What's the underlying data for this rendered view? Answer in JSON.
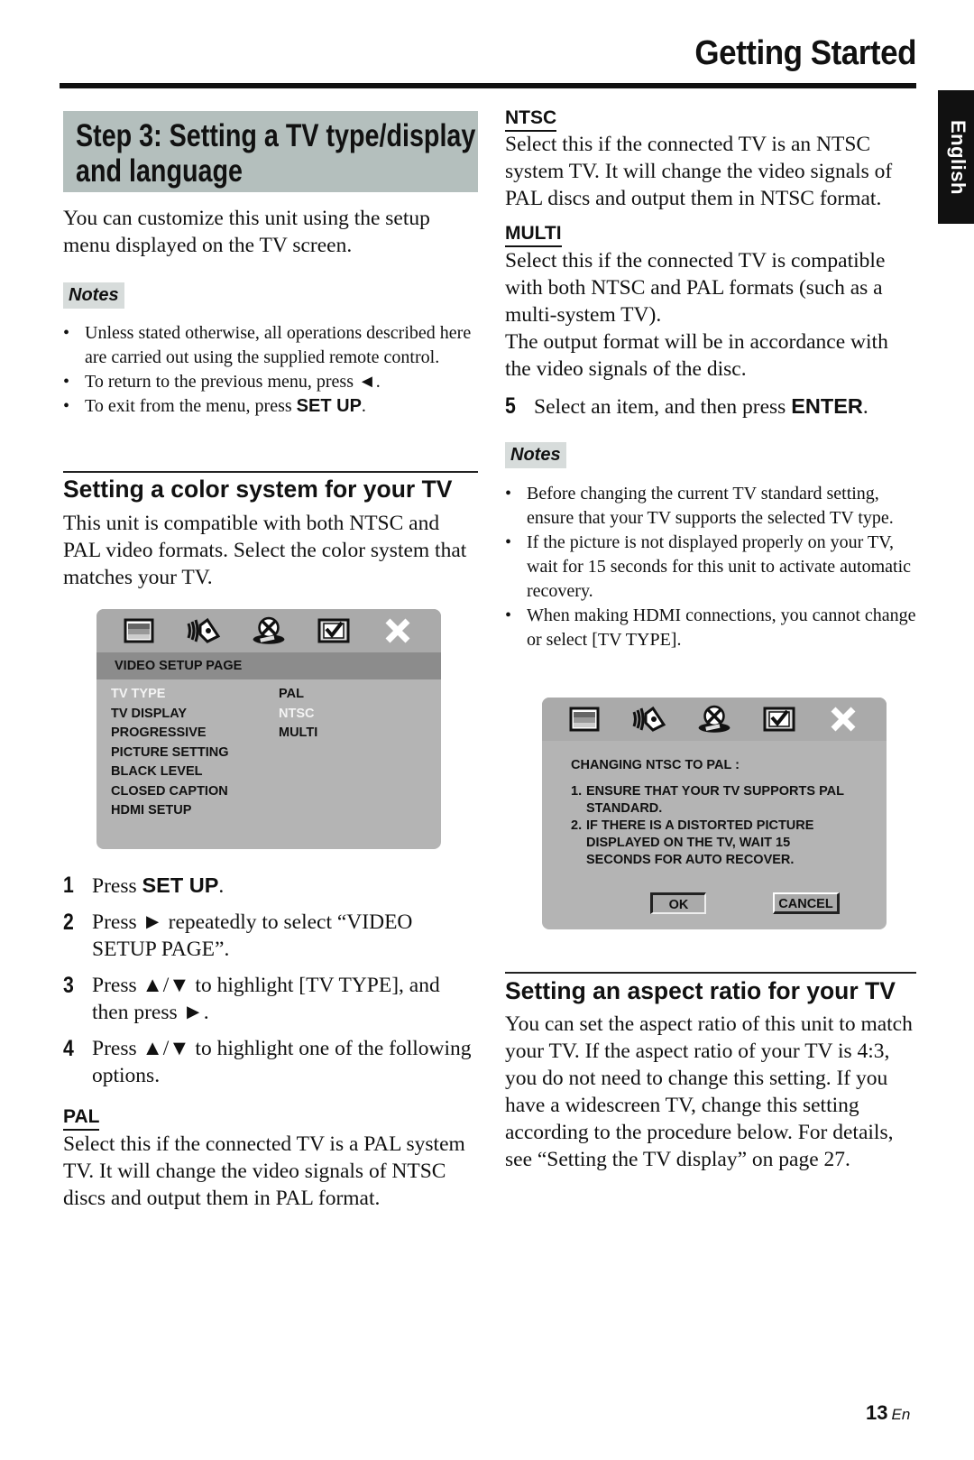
{
  "header": {
    "title": "Getting Started",
    "language_tab": "English"
  },
  "left": {
    "step_title_line1": "Step 3: Setting a TV type/display",
    "step_title_line2": "and language",
    "intro": "You can customize this unit using the setup menu displayed on the TV screen.",
    "notes": {
      "label": "Notes",
      "items": [
        {
          "text": "Unless stated otherwise, all operations described here are carried out using the supplied remote control."
        },
        {
          "text": "To return to the previous menu, press ◄."
        },
        {
          "pre": "To exit from the menu, press ",
          "key": "SET UP",
          "post": "."
        }
      ]
    },
    "color_section": {
      "title": "Setting a color system for your TV",
      "body": "This unit is compatible with both NTSC and PAL video formats. Select the color system that matches your TV."
    },
    "osd_menu": {
      "icons": [
        "tv-screen-icon",
        "speaker-icon",
        "video-reel-icon",
        "preference-icon",
        "exit-x-icon"
      ],
      "page_title": "VIDEO SETUP PAGE",
      "items": [
        {
          "label": "TV TYPE",
          "highlighted": true
        },
        {
          "label": "TV DISPLAY",
          "highlighted": false
        },
        {
          "label": "PROGRESSIVE",
          "highlighted": false
        },
        {
          "label": "PICTURE SETTING",
          "highlighted": false
        },
        {
          "label": "BLACK LEVEL",
          "highlighted": false
        },
        {
          "label": "CLOSED CAPTION",
          "highlighted": false
        },
        {
          "label": "HDMI SETUP",
          "highlighted": false
        }
      ],
      "options": [
        {
          "label": "PAL",
          "highlighted": false
        },
        {
          "label": "NTSC",
          "highlighted": true
        },
        {
          "label": "MULTI",
          "highlighted": false
        }
      ]
    },
    "steps": [
      {
        "num": "1",
        "pre": "Press ",
        "key": "SET UP",
        "post": "."
      },
      {
        "num": "2",
        "text": "Press ► repeatedly to select “VIDEO SETUP PAGE”."
      },
      {
        "num": "3",
        "text": "Press ▲/▼ to highlight [TV TYPE], and then press ►."
      },
      {
        "num": "4",
        "text": "Press ▲/▼ to highlight one of the following options."
      }
    ],
    "pal": {
      "heading": "PAL",
      "body": "Select this if the connected TV is a PAL system TV. It will change the video signals of NTSC discs and output them in PAL format."
    }
  },
  "right": {
    "ntsc": {
      "heading": "NTSC",
      "body": "Select this if the connected TV is an NTSC system TV. It will change the video signals of PAL discs and output them in NTSC format."
    },
    "multi": {
      "heading": "MULTI",
      "body1": "Select this if the connected TV is compatible with both NTSC and PAL formats (such as a multi-system TV).",
      "body2": "The output format will be in accordance with the video signals of the disc."
    },
    "step5": {
      "num": "5",
      "pre": "Select an item, and then press ",
      "key": "ENTER",
      "post": "."
    },
    "notes": {
      "label": "Notes",
      "items": [
        "Before changing the current TV standard setting, ensure that your TV supports the selected TV type.",
        "If the picture is not displayed properly on your TV, wait for 15 seconds for this unit to activate automatic recovery.",
        "When making HDMI connections, you cannot change or select [TV TYPE]."
      ]
    },
    "dialog": {
      "heading": "CHANGING NTSC TO PAL :",
      "items": [
        {
          "n": "1.",
          "text": "ENSURE THAT YOUR TV SUPPORTS PAL STANDARD."
        },
        {
          "n": "2.",
          "text": "IF THERE IS A DISTORTED PICTURE DISPLAYED ON THE TV, WAIT 15 SECONDS FOR AUTO RECOVER."
        }
      ],
      "ok_label": "OK",
      "cancel_label": "CANCEL"
    },
    "aspect_section": {
      "title": "Setting an aspect ratio for your TV",
      "body": "You can set the aspect ratio of this unit to match your TV. If the aspect ratio of your TV is 4:3, you do not need to change this setting. If you have a widescreen TV, change this setting according to the procedure below. For details, see “Setting the TV display” on page 27."
    }
  },
  "footer": {
    "page_number": "13",
    "page_suffix": "En"
  },
  "colors": {
    "title_box": "#b4bfbd",
    "notes_label_bg": "#d7dcdb",
    "osd_bg": "#b4b4b4",
    "osd_title_bar": "#8c8c8c",
    "language_tab": "#111111"
  }
}
